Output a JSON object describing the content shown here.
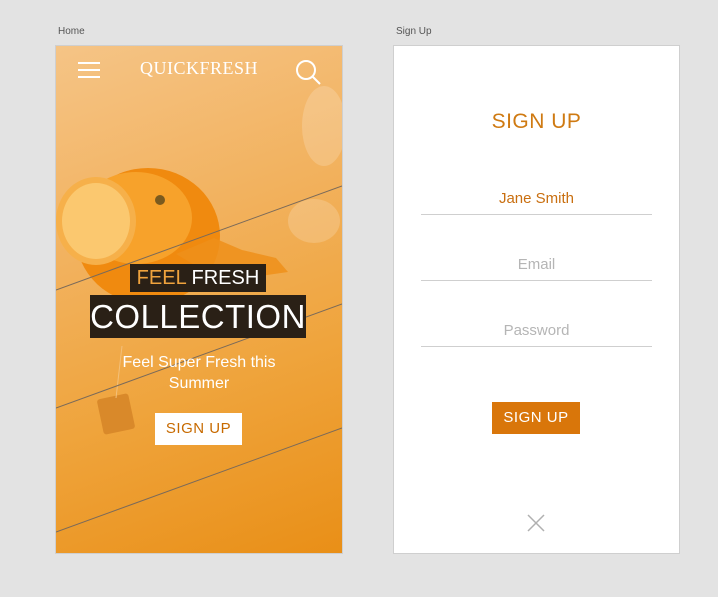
{
  "artboards": {
    "home_label": "Home",
    "signup_label": "Sign Up"
  },
  "home": {
    "brand": "QUICKFRESH",
    "tagline_feel": "FEEL",
    "tagline_fresh": "FRESH",
    "collection": "COLLECTION",
    "subtitle": "Feel Super Fresh this Summer",
    "cta_label": "SIGN UP",
    "icons": {
      "menu": "hamburger-menu-icon",
      "search": "search-icon"
    }
  },
  "signup": {
    "title": "SIGN UP",
    "name_value": "Jane Smith",
    "email_placeholder": "Email",
    "password_placeholder": "Password",
    "submit_label": "SIGN UP",
    "icons": {
      "close": "close-icon"
    }
  },
  "colors": {
    "accent": "#d9760a",
    "dark_tag": "#2a2016",
    "canvas": "#e3e3e3"
  }
}
